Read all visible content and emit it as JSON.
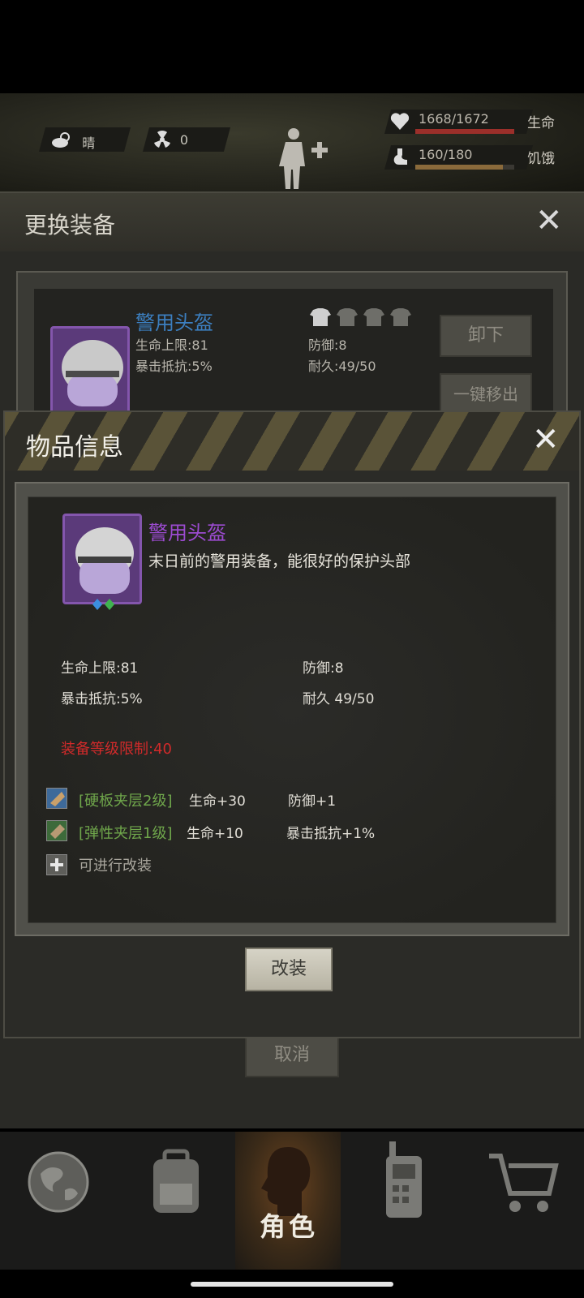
{
  "status": {
    "weather": "晴",
    "radiation": "0",
    "hp": {
      "value": "1668/1672",
      "label": "生命",
      "fill": 0.998,
      "color": "#9b2f2a"
    },
    "hunger": {
      "value": "160/180",
      "label": "饥饿",
      "fill": 0.889,
      "color": "#8a6a3b"
    }
  },
  "equip_panel": {
    "title": "更换装备",
    "item_name": "警用头盔",
    "hp_max": "生命上限:81",
    "defense": "防御:8",
    "crit_resist": "暴击抵抗:5%",
    "durability": "耐久:49/50",
    "unequip_button": "卸下",
    "remove_all_button": "一键移出"
  },
  "info_panel": {
    "title": "物品信息",
    "item_name": "警用头盔",
    "description": "末日前的警用装备，能很好的保护头部",
    "attrs": {
      "hp_max": "生命上限:81",
      "defense": "防御:8",
      "crit_resist": "暴击抵抗:5%",
      "durability": "耐久 49/50"
    },
    "level_limit": "装备等级限制:40",
    "mods": [
      {
        "name": "[硬板夹层2级]",
        "stat1": "生命+30",
        "stat2": "防御+1"
      },
      {
        "name": "[弹性夹层1级]",
        "stat1": "生命+10",
        "stat2": "暴击抵抗+1%"
      }
    ],
    "add_mod_text": "可进行改装",
    "modify_button": "改装",
    "cancel_button": "取消"
  },
  "nav": {
    "role_label": "角色"
  }
}
